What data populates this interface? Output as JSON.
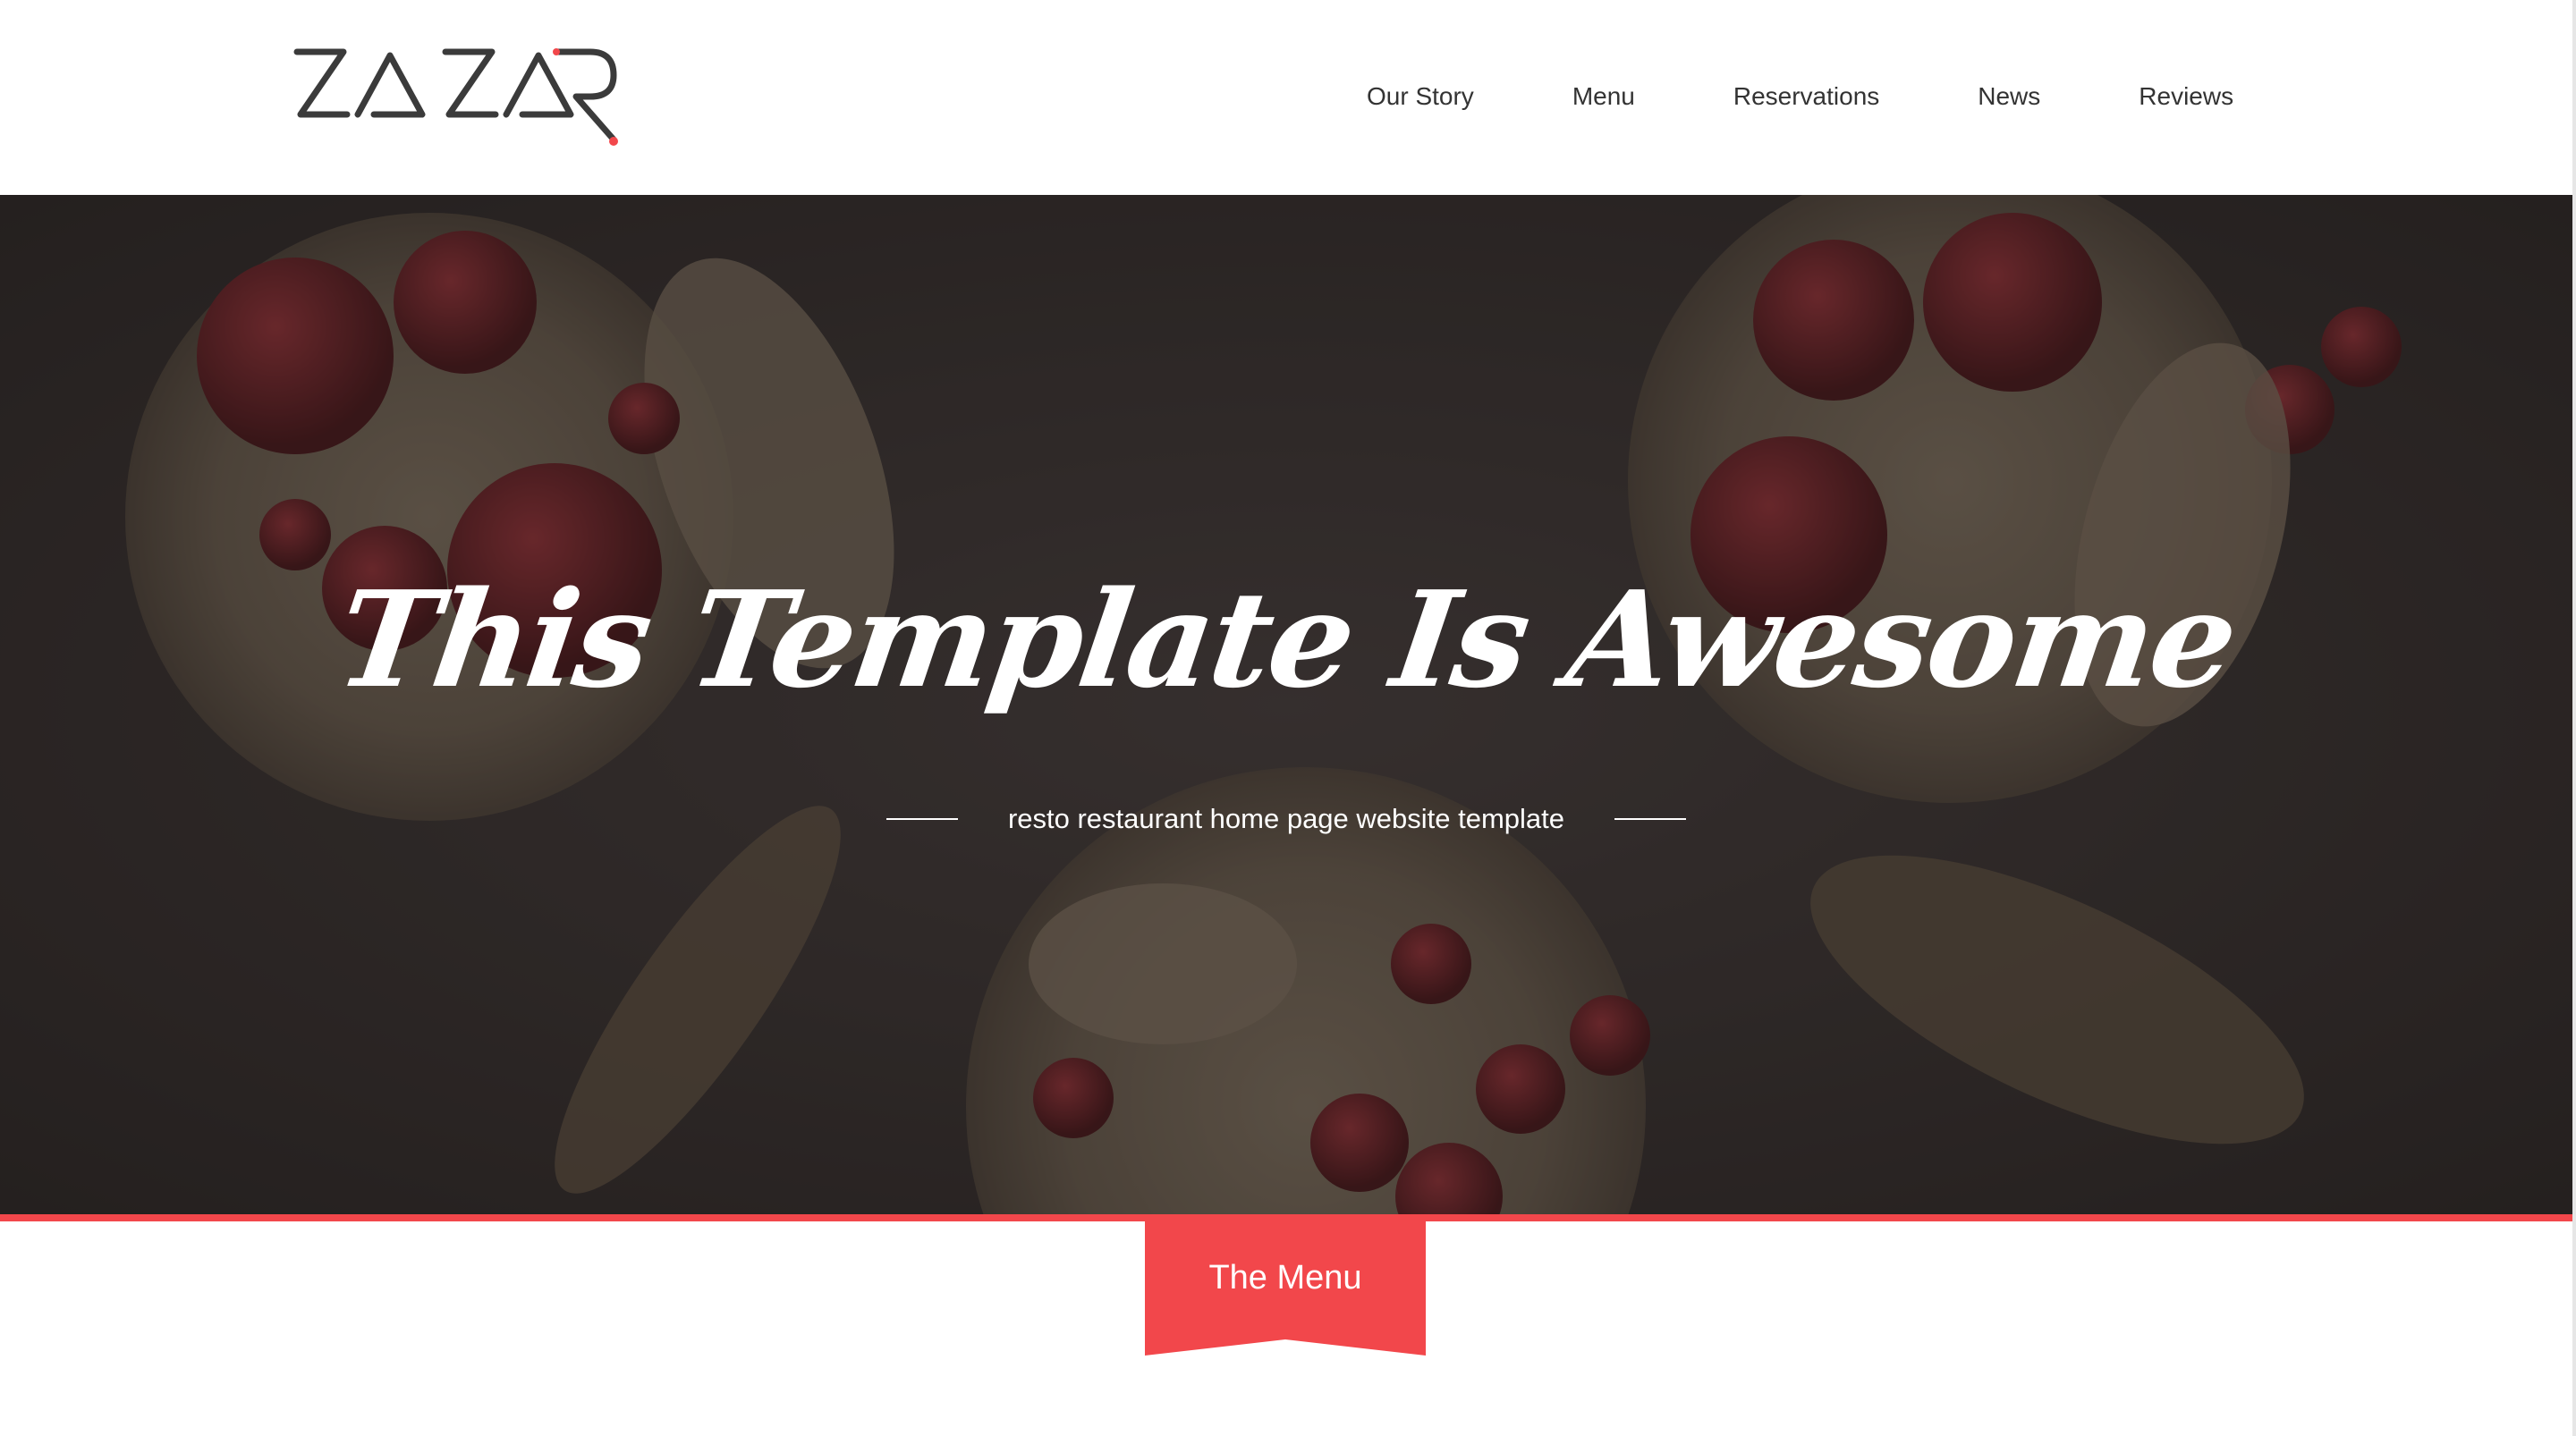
{
  "header": {
    "logo_text": "ZA ZAR",
    "nav": [
      {
        "label": "Our Story"
      },
      {
        "label": "Menu"
      },
      {
        "label": "Reservations"
      },
      {
        "label": "News"
      },
      {
        "label": "Reviews"
      }
    ]
  },
  "hero": {
    "title": "This Template Is Awesome",
    "subtitle": "resto restaurant home page website template"
  },
  "menu_section": {
    "ribbon_label": "The Menu"
  },
  "colors": {
    "accent": "#f2474b",
    "nav_text": "#333333",
    "logo": "#3b3b3b",
    "hero_overlay": "#3a3432"
  }
}
